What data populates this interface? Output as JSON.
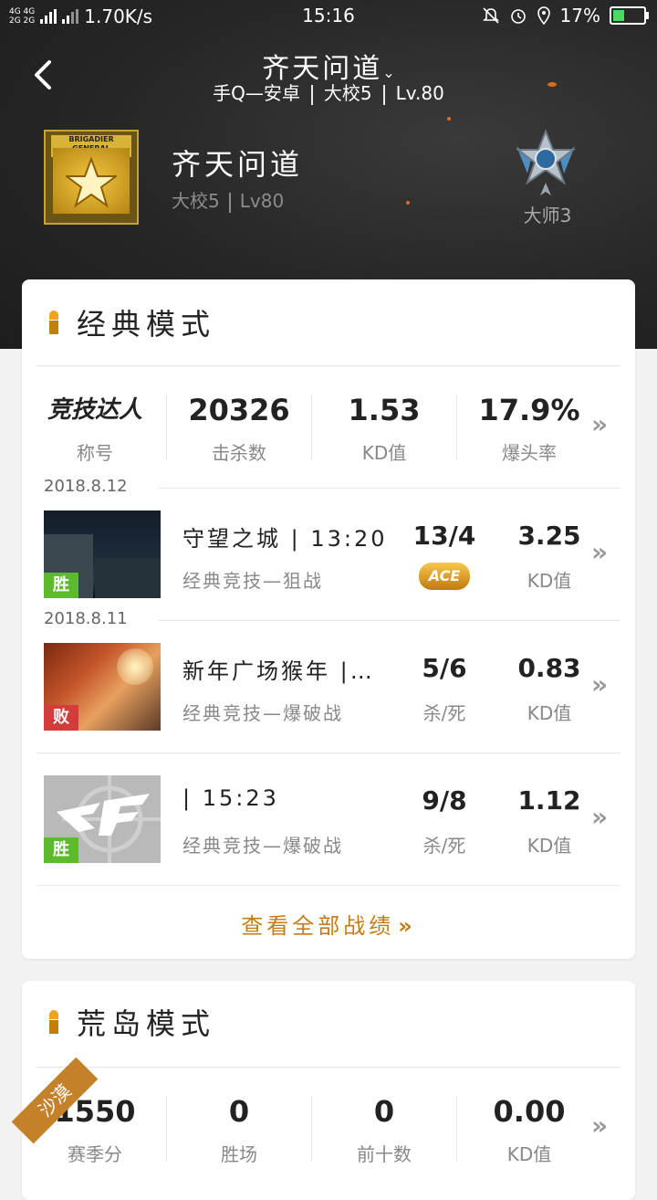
{
  "status_bar": {
    "network": "4G 4G",
    "network2": "2G 2G",
    "speed": "1.70K/s",
    "time": "15:16",
    "battery": "17%"
  },
  "header": {
    "title": "齐天问道",
    "subtitle": {
      "platform": "手Q—安卓",
      "rank": "大校5",
      "level": "Lv.80"
    }
  },
  "player": {
    "badge_text": "BRIGADIER GENERAL",
    "name": "齐天问道",
    "rank": "大校5",
    "level": "Lv80",
    "tier": "大师3"
  },
  "classic": {
    "title": "经典模式",
    "summary": {
      "title_label": "竞技达人",
      "title_caption": "称号",
      "kills": "20326",
      "kills_label": "击杀数",
      "kd": "1.53",
      "kd_label": "KD值",
      "headshot": "17.9%",
      "headshot_label": "爆头率"
    },
    "matches": [
      {
        "date": "2018.8.12",
        "result": "胜",
        "map": "守望之城 | 13:20",
        "mode": "经典竞技—狙战",
        "score": "13/4",
        "badge": "ACE",
        "kd": "3.25",
        "kd_label": "KD值"
      },
      {
        "date": "2018.8.11",
        "result": "败",
        "map": "新年广场猴年 |…",
        "mode": "经典竞技—爆破战",
        "score": "5/6",
        "score_label": "杀/死",
        "kd": "0.83",
        "kd_label": "KD值"
      },
      {
        "result": "胜",
        "map": "| 15:23",
        "mode": "经典竞技—爆破战",
        "score": "9/8",
        "score_label": "杀/死",
        "kd": "1.12",
        "kd_label": "KD值"
      }
    ],
    "view_all": "查看全部战绩"
  },
  "island": {
    "title": "荒岛模式",
    "ribbon": "沙漠",
    "stats": [
      {
        "value": "1550",
        "label": "赛季分"
      },
      {
        "value": "0",
        "label": "胜场"
      },
      {
        "value": "0",
        "label": "前十数"
      },
      {
        "value": "0.00",
        "label": "KD值"
      }
    ]
  },
  "colors": {
    "accent": "#c47d16",
    "win": "#5bbb2d",
    "lose": "#d43c3c"
  }
}
